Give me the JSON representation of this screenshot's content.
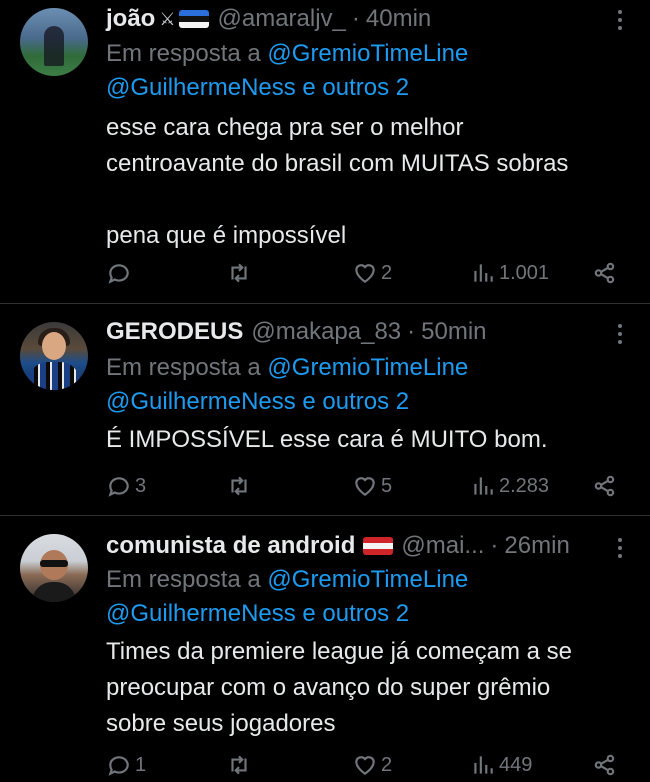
{
  "tweets": [
    {
      "name": "joão",
      "handle": "@amaraljv_",
      "dot": "·",
      "time": "40min",
      "reply_prefix": "Em resposta a",
      "reply_to": "@GremioTimeLine",
      "mentions": "@GuilhermeNess e outros 2",
      "text": "esse cara chega pra ser o melhor\ncentroavante do brasil com MUITAS sobras\n\npena que é impossível",
      "replies": "",
      "retweets": "",
      "likes": "2",
      "views": "1.001"
    },
    {
      "name": "GERODEUS",
      "handle": "@makapa_83",
      "dot": "·",
      "time": "50min",
      "reply_prefix": "Em resposta a",
      "reply_to": "@GremioTimeLine",
      "mentions": "@GuilhermeNess e outros 2",
      "text": "É IMPOSSÍVEL esse cara é MUITO bom.",
      "replies": "3",
      "retweets": "",
      "likes": "5",
      "views": "2.283"
    },
    {
      "name": "comunista de android",
      "handle": "@mai...",
      "dot": "·",
      "time": "26min",
      "reply_prefix": "Em resposta a",
      "reply_to": "@GremioTimeLine",
      "mentions": "@GuilhermeNess e outros 2",
      "text": "Times da premiere league já começam a se\npreocupar com o avanço do super grêmio\nsobre seus jogadores",
      "replies": "1",
      "retweets": "",
      "likes": "2",
      "views": "449"
    }
  ],
  "icons": {
    "reply": "reply-icon",
    "retweet": "retweet-icon",
    "like": "heart-icon",
    "views": "views-icon",
    "share": "share-icon",
    "more": "more-icon"
  },
  "colors": {
    "background": "#000000",
    "text": "#e7e9ea",
    "muted": "#71767b",
    "link": "#1d9bf0",
    "divider": "#2f3336"
  }
}
